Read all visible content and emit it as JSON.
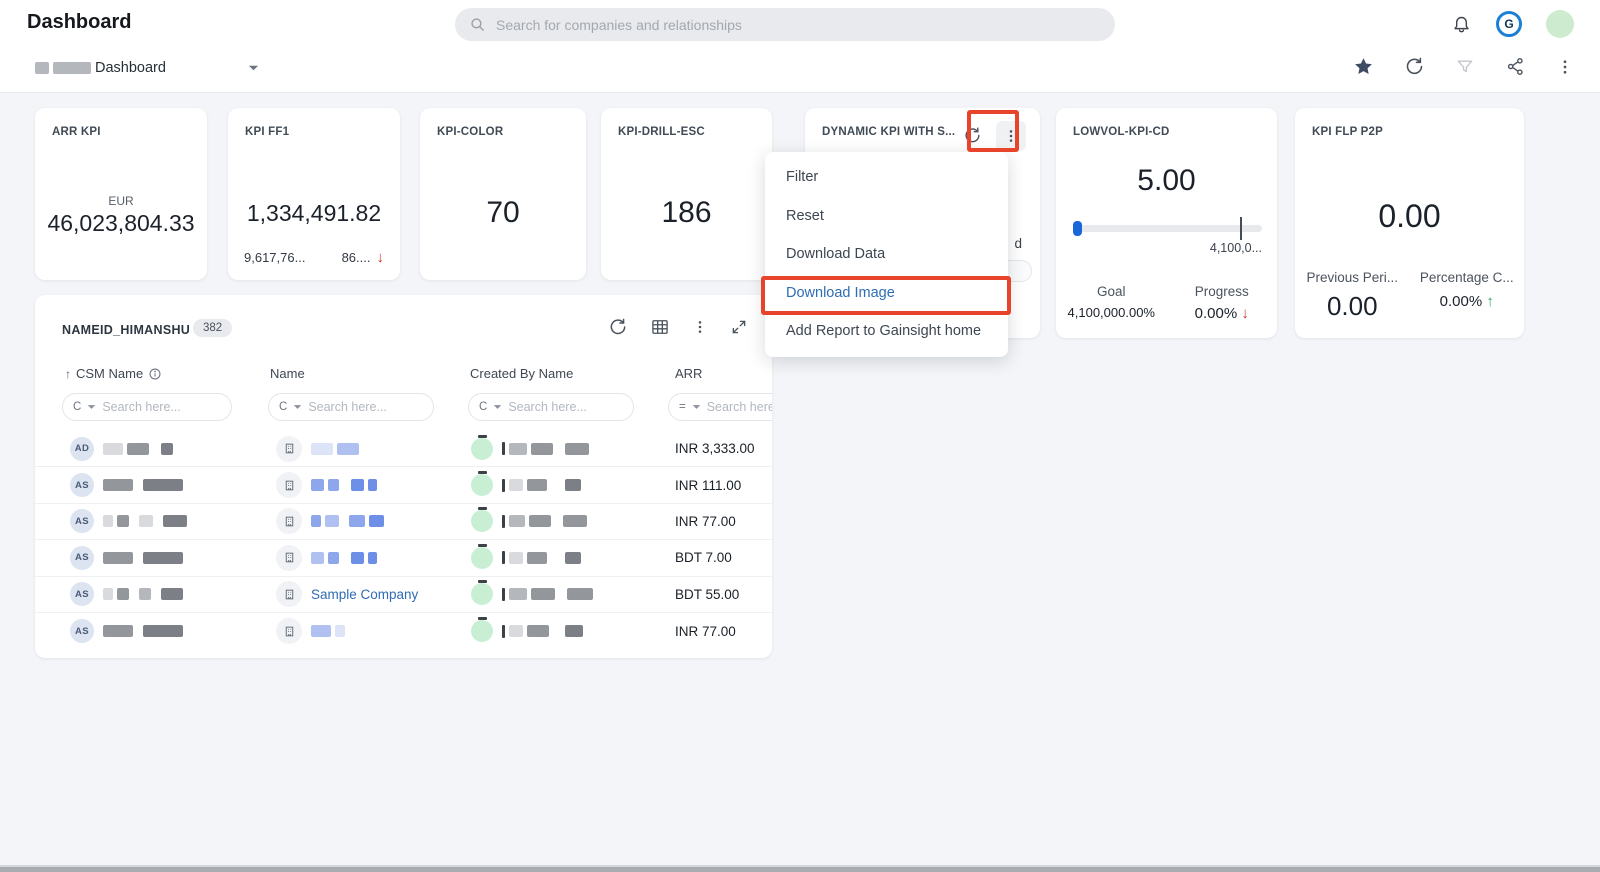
{
  "header": {
    "title": "Dashboard",
    "search_placeholder": "Search for companies and relationships",
    "logo_letter": "G"
  },
  "toolbar": {
    "dashboard_label": "Dashboard"
  },
  "glyphs": {
    "trend_down": "↓",
    "trend_up": "↑",
    "sort_asc": "↑"
  },
  "kpi_cards": {
    "arr_kpi": {
      "title": "ARR KPI",
      "currency": "EUR",
      "value": "46,023,804.33"
    },
    "kpi_ff1": {
      "title": "KPI FF1",
      "value": "1,334,491.82",
      "footer_left": "9,617,76...",
      "footer_right": "86...."
    },
    "kpi_color": {
      "title": "KPI-COLOR",
      "value": "70"
    },
    "kpi_drill_esc": {
      "title": "KPI-DRILL-ESC",
      "value": "186"
    },
    "dynamic_kpi": {
      "title": "DYNAMIC KPI WITH S...",
      "peek_text": "d"
    },
    "lowvol": {
      "title": "LOWVOL-KPI-CD",
      "value": "5.00",
      "slider_max_label": "4,100,0...",
      "goal_label": "Goal",
      "goal_value": "4,100,000.00%",
      "progress_label": "Progress",
      "progress_value": "0.00%"
    },
    "kpi_flp": {
      "title": "KPI FLP P2P",
      "value": "0.00",
      "previous_label": "Previous Peri...",
      "previous_value": "0.00",
      "percentage_label": "Percentage C...",
      "percentage_value": "0.00%"
    }
  },
  "context_menu": {
    "filter": "Filter",
    "reset": "Reset",
    "download_data": "Download Data",
    "download_image": "Download Image",
    "add_report": "Add Report to Gainsight home"
  },
  "report": {
    "title": "NAMEID_HIMANSHU",
    "count": "382",
    "columns": {
      "csm": "CSM Name",
      "name": "Name",
      "created_by": "Created By Name",
      "arr": "ARR"
    },
    "filters": {
      "op_contains": "C",
      "op_equals": "=",
      "placeholder": "Search here..."
    },
    "rows": [
      {
        "initials": "AD",
        "arr": "INR 3,333.00"
      },
      {
        "initials": "AS",
        "arr": "INR 111.00"
      },
      {
        "initials": "AS",
        "arr": "INR 77.00"
      },
      {
        "initials": "AS",
        "arr": "BDT 7.00"
      },
      {
        "initials": "AS",
        "name": "Sample Company",
        "arr": "BDT 55.00"
      },
      {
        "initials": "AS",
        "arr": "INR 77.00"
      }
    ]
  },
  "colors": {
    "annotation": "#e8432b",
    "menu_highlight_link": "#2e6db4",
    "negative": "#c8372a",
    "positive": "#27a567",
    "slider_accent": "#1b66d9"
  }
}
